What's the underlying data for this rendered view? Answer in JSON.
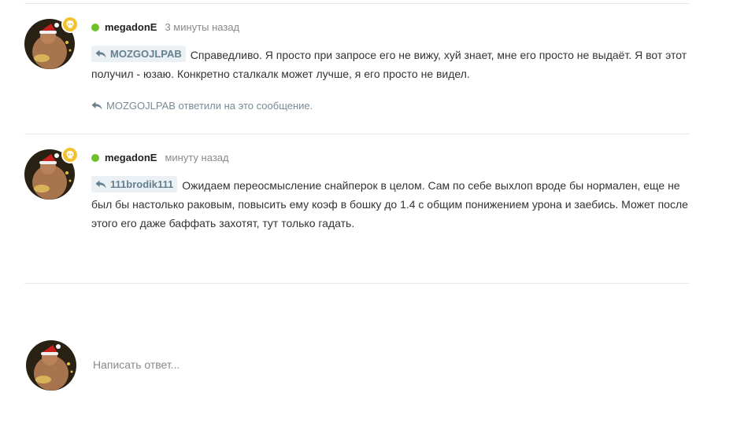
{
  "comments": [
    {
      "author": "megadonE",
      "time": "3 минуты назад",
      "reply_to": "MOZGOJLPAB",
      "text": "Справедливо. Я просто при запросе его не вижу, хуй знает, мне его просто не выдаёт. Я вот этот получил - юзаю. Конкретно сталкалк может лучше, я его просто не видел.",
      "answered_note": "MOZGOJLPAB ответили на это сообщение."
    },
    {
      "author": "megadonE",
      "time": "минуту назад",
      "reply_to": "111brodik111",
      "text": "Ожидаем переосмысление снайперок в целом. Сам по себе выхлоп вроде бы нормален, еще не был бы настолько раковым, повысить ему коэф в бошку до 1.4 с общим понижением урона и заебись. Может после этого его даже баффать захотят, тут только гадать."
    }
  ],
  "composer": {
    "placeholder": "Написать ответ..."
  },
  "colors": {
    "online": "#6fc02a",
    "badge": "#f2c230",
    "chip_bg": "#eaf0f3",
    "chip_text": "#647f8e"
  },
  "icons": {
    "badge": "skull-icon",
    "reply": "reply-arrow-icon",
    "online": "online-dot-icon"
  }
}
